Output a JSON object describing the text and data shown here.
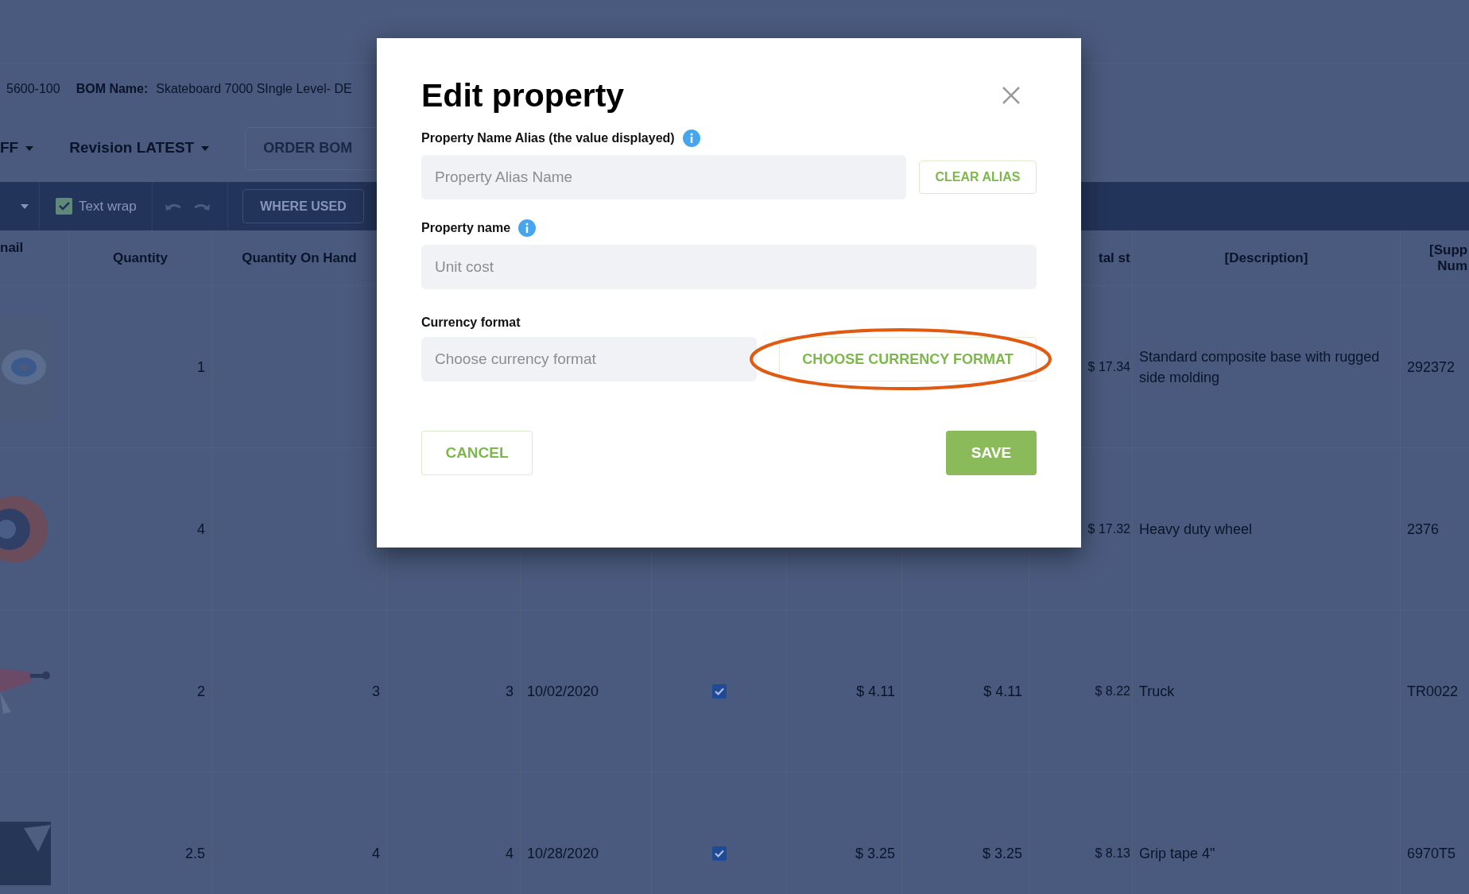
{
  "header": {
    "part_number": "5600-100",
    "bom_label": "BOM Name:",
    "bom_name": "Skateboard 7000 SIngle Level- DE"
  },
  "toolbar": {
    "filter_dropdown": "FF",
    "revision_label": "Revision",
    "revision_value": "LATEST",
    "order_button": "ORDER BOM"
  },
  "grid_toolbar": {
    "text_wrap": {
      "label": "Text wrap",
      "checked": true
    },
    "where_used": "WHERE USED"
  },
  "table": {
    "columns": {
      "column_1": "nail",
      "quantity": "Quantity",
      "quantity_on_hand": "Quantity On Hand",
      "column_9": "tal st",
      "description": "[Description]",
      "column_11": "[Supp Num"
    },
    "rows": [
      {
        "quantity": "1",
        "total_cost": "$ 17.34",
        "description": "Standard composite base with rugged side molding",
        "column_11": "292372"
      },
      {
        "quantity": "4",
        "total_cost": "$ 17.32",
        "description": "Heavy duty wheel",
        "column_11": "2376"
      },
      {
        "quantity": "2",
        "quantity_on_hand": "3",
        "column_4": "3",
        "column_5": "10/02/2020",
        "column_6": {
          "checked": true
        },
        "column_7": "$ 4.11",
        "column_8": "$ 4.11",
        "total_cost": "$ 8.22",
        "description": "Truck",
        "column_11": "TR0022"
      },
      {
        "quantity": "2.5",
        "quantity_on_hand": "4",
        "column_4": "4",
        "column_5": "10/28/2020",
        "column_6": {
          "checked": true
        },
        "column_7": "$ 3.25",
        "column_8": "$ 3.25",
        "total_cost": "$ 8.13",
        "description": "Grip tape 4\"",
        "column_11": "6970T5"
      }
    ]
  },
  "dialog": {
    "title": "Edit property",
    "alias": {
      "label": "Property Name Alias (the value displayed)",
      "placeholder": "Property Alias Name",
      "clear_button": "CLEAR ALIAS"
    },
    "property_name": {
      "label": "Property name",
      "value": "Unit cost",
      "disabled": true
    },
    "currency": {
      "label": "Currency format",
      "placeholder": "Choose currency format",
      "choose_button": "CHOOSE CURRENCY FORMAT",
      "highlighted": true
    },
    "cancel_button": "CANCEL",
    "save_button": "SAVE"
  }
}
